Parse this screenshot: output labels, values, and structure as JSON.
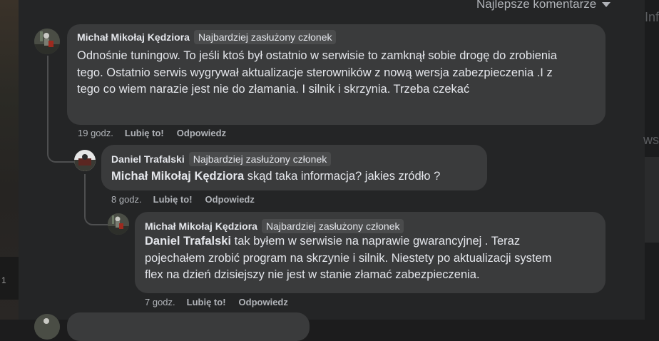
{
  "sort_label": "Najlepsze komentarze",
  "background": {
    "left_number": "1",
    "right_text1": "Inf",
    "right_text2": "wsz"
  },
  "comments": [
    {
      "author": "Michał Mikołaj Kędziora",
      "badge": "Najbardziej zasłużony członek",
      "mention": "",
      "text": "Odnośnie tuningow. To jeśli ktoś był ostatnio w serwisie to zamknął sobie drogę do zrobienia tego. Ostatnio serwis wygrywał aktualizacje sterowników z nową wersja zabezpieczenia .I z tego co wiem narazie jest nie do złamania. I silnik i skrzynia. Trzeba czekać",
      "time": "19 godz.",
      "like": "Lubię to!",
      "reply": "Odpowiedz"
    },
    {
      "author": "Daniel Trafalski",
      "badge": "Najbardziej zasłużony członek",
      "mention": "Michał Mikołaj Kędziora",
      "text": " skąd taka informacja? jakies zródło ?",
      "time": "8 godz.",
      "like": "Lubię to!",
      "reply": "Odpowiedz"
    },
    {
      "author": "Michał Mikołaj Kędziora",
      "badge": "Najbardziej zasłużony członek",
      "mention": "Daniel Trafalski",
      "text": " tak byłem w serwisie na naprawie gwarancyjnej . Teraz pojechałem zrobić program na skrzynie i silnik. Niestety po aktualizacji system flex na dzień dzisiejszy nie jest w stanie złamać zabezpieczenia.",
      "time": "7 godz.",
      "like": "Lubię to!",
      "reply": "Odpowiedz"
    }
  ]
}
